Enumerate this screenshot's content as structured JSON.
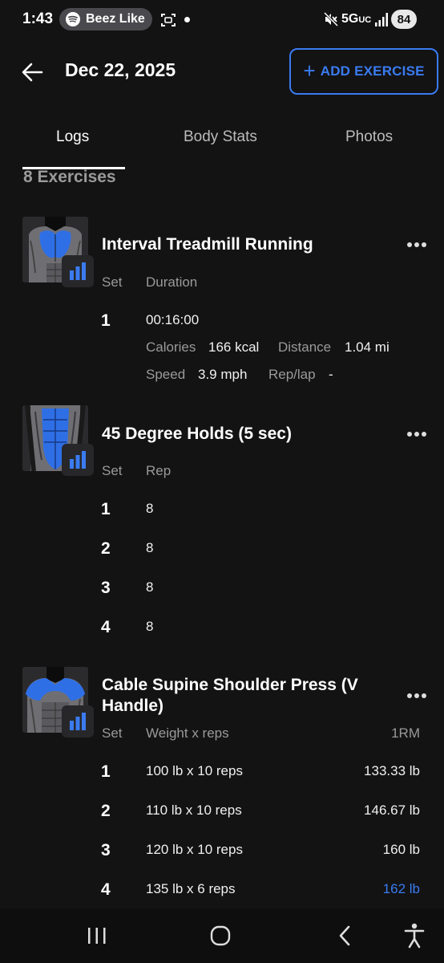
{
  "status_bar": {
    "time": "1:43",
    "now_playing": "Beez Like",
    "network": "5G",
    "network_suffix": "UC",
    "battery": "84"
  },
  "header": {
    "date": "Dec 22, 2025",
    "add_button": "ADD EXERCISE",
    "add_icon": "+"
  },
  "tabs": [
    {
      "label": "Logs",
      "active": true
    },
    {
      "label": "Body Stats",
      "active": false
    },
    {
      "label": "Photos",
      "active": false
    }
  ],
  "exercise_count": "8 Exercises",
  "exercises": [
    {
      "name": "Interval Treadmill Running",
      "col_set": "Set",
      "col_value": "Duration",
      "sets": [
        {
          "set": "1",
          "duration": "00:16:00",
          "calories_label": "Calories",
          "calories": "166 kcal",
          "distance_label": "Distance",
          "distance": "1.04 mi",
          "speed_label": "Speed",
          "speed": "3.9 mph",
          "replap_label": "Rep/lap",
          "replap": "-"
        }
      ]
    },
    {
      "name": "45 Degree Holds (5 sec)",
      "col_set": "Set",
      "col_value": "Rep",
      "sets": [
        {
          "set": "1",
          "value": "8"
        },
        {
          "set": "2",
          "value": "8"
        },
        {
          "set": "3",
          "value": "8"
        },
        {
          "set": "4",
          "value": "8"
        }
      ]
    },
    {
      "name_line1": "Cable Supine Shoulder Press (V",
      "name_line2": "Handle)",
      "col_set": "Set",
      "col_value": "Weight x reps",
      "col_1rm": "1RM",
      "sets": [
        {
          "set": "1",
          "value": "100 lb x 10 reps",
          "one_rm": "133.33 lb",
          "pr": false
        },
        {
          "set": "2",
          "value": "110 lb x 10 reps",
          "one_rm": "146.67 lb",
          "pr": false
        },
        {
          "set": "3",
          "value": "120 lb x 10 reps",
          "one_rm": "160 lb",
          "pr": false
        },
        {
          "set": "4",
          "value": "135 lb x 6 reps",
          "one_rm": "162 lb",
          "pr": true
        }
      ]
    }
  ],
  "colors": {
    "accent": "#3a7bf0",
    "muscle_highlight": "#2f6fe6",
    "background": "#131314",
    "muted_text": "#9a9a9a"
  },
  "icons": {
    "back": "arrow-left-icon",
    "more": "more-horizontal-icon",
    "stats": "bar-chart-icon",
    "nav_recents": "recents-icon",
    "nav_home": "home-icon",
    "nav_back": "chevron-left-icon",
    "nav_accessibility": "accessibility-icon"
  }
}
